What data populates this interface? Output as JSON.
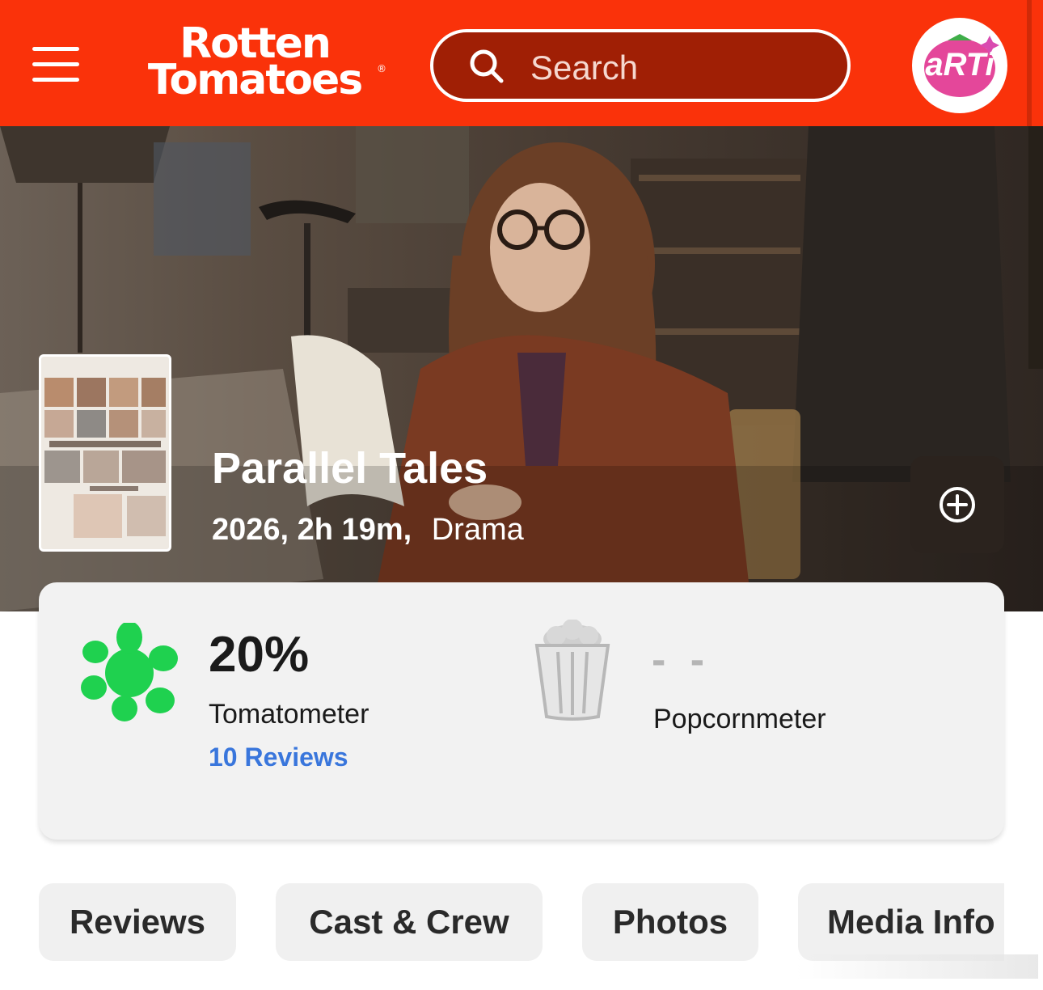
{
  "header": {
    "logo_line1": "Rotten",
    "logo_line2": "Tomatoes",
    "registered_mark": "®",
    "search_placeholder": "Search",
    "avatar_text": "aRTi",
    "brand_color": "#fa320a"
  },
  "movie": {
    "title": "Parallel Tales",
    "year_runtime": "2026, 2h 19m,",
    "genre": "Drama"
  },
  "scores": {
    "tomatometer_value": "20%",
    "tomatometer_label": "Tomatometer",
    "reviews_link": "10 Reviews",
    "popcornmeter_value": "- -",
    "popcornmeter_label": "Popcornmeter",
    "tomatometer_icon": "green-splat-icon",
    "popcornmeter_icon": "empty-popcorn-icon",
    "accent_green": "#1fd14f",
    "link_blue": "#3976dc"
  },
  "tabs": [
    {
      "label": "Reviews"
    },
    {
      "label": "Cast & Crew"
    },
    {
      "label": "Photos"
    },
    {
      "label": "Media Info"
    }
  ]
}
